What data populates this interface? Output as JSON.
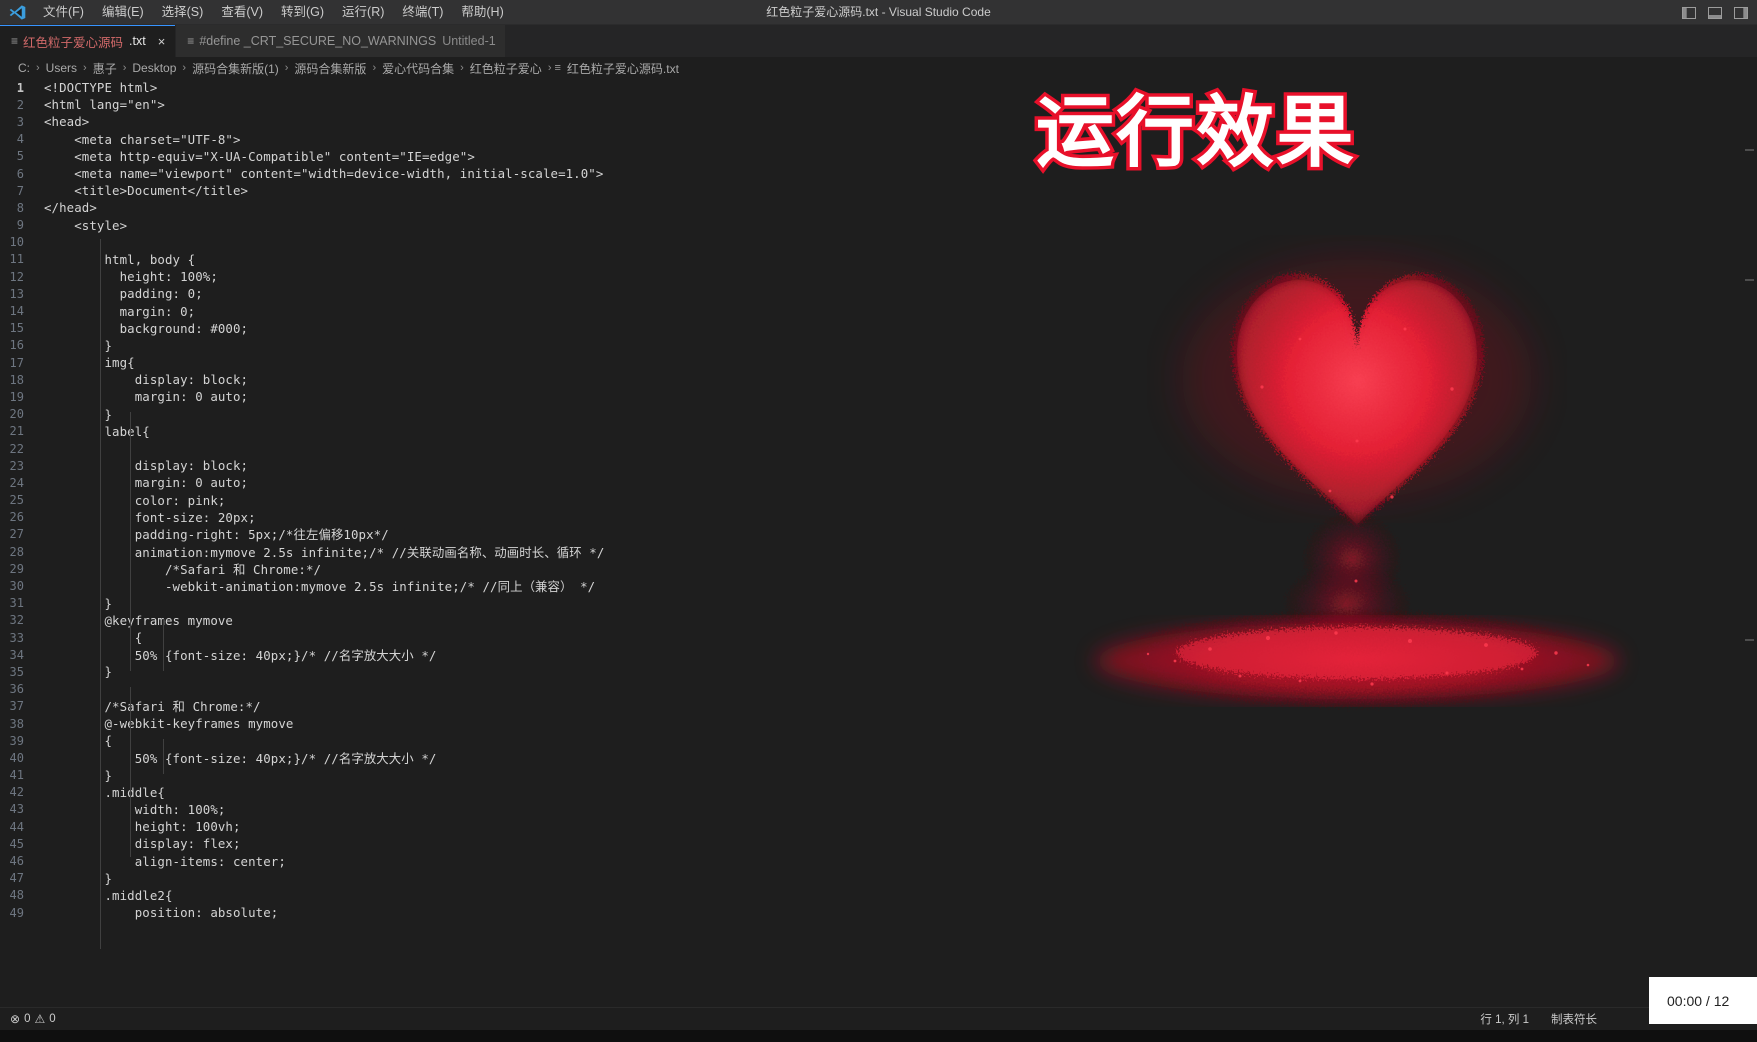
{
  "window": {
    "title": "红色粒子爱心源码.txt - Visual Studio Code",
    "logo_name": "vscode-logo"
  },
  "menu": {
    "items": [
      {
        "label": "文件(F)"
      },
      {
        "label": "编辑(E)"
      },
      {
        "label": "选择(S)"
      },
      {
        "label": "查看(V)"
      },
      {
        "label": "转到(G)"
      },
      {
        "label": "运行(R)"
      },
      {
        "label": "终端(T)"
      },
      {
        "label": "帮助(H)"
      }
    ]
  },
  "title_actions": [
    {
      "name": "toggle-primary-sidebar-icon"
    },
    {
      "name": "toggle-panel-icon"
    },
    {
      "name": "toggle-secondary-sidebar-icon"
    }
  ],
  "tabs": [
    {
      "label": "红色粒子爱心源码",
      "ext": ".txt",
      "active": true,
      "close": "×",
      "icon": "text-file-icon"
    },
    {
      "label": "#define _CRT_SECURE_NO_WARNINGS",
      "sub": "Untitled-1",
      "active": false,
      "dirty": true,
      "icon": "text-file-icon"
    }
  ],
  "breadcrumb": {
    "separator": "›",
    "segments": [
      "C:",
      "Users",
      "惠子",
      "Desktop",
      "源码合集新版(1)",
      "源码合集新版",
      "爱心代码合集",
      "红色粒子爱心"
    ],
    "file": "红色粒子爱心源码.txt"
  },
  "editor": {
    "active_line": 1,
    "lines": [
      {
        "n": 1,
        "text": "<!DOCTYPE html>"
      },
      {
        "n": 2,
        "text": "<html lang=\"en\">"
      },
      {
        "n": 3,
        "text": "<head>"
      },
      {
        "n": 4,
        "text": "    <meta charset=\"UTF-8\">"
      },
      {
        "n": 5,
        "text": "    <meta http-equiv=\"X-UA-Compatible\" content=\"IE=edge\">"
      },
      {
        "n": 6,
        "text": "    <meta name=\"viewport\" content=\"width=device-width, initial-scale=1.0\">"
      },
      {
        "n": 7,
        "text": "    <title>Document</title>"
      },
      {
        "n": 8,
        "text": "</head>"
      },
      {
        "n": 9,
        "text": "    <style>"
      },
      {
        "n": 10,
        "text": ""
      },
      {
        "n": 11,
        "text": "        html, body {"
      },
      {
        "n": 12,
        "text": "          height: 100%;"
      },
      {
        "n": 13,
        "text": "          padding: 0;"
      },
      {
        "n": 14,
        "text": "          margin: 0;"
      },
      {
        "n": 15,
        "text": "          background: #000;"
      },
      {
        "n": 16,
        "text": "        }"
      },
      {
        "n": 17,
        "text": "        img{"
      },
      {
        "n": 18,
        "text": "            display: block;"
      },
      {
        "n": 19,
        "text": "            margin: 0 auto;"
      },
      {
        "n": 20,
        "text": "        }"
      },
      {
        "n": 21,
        "text": "        label{"
      },
      {
        "n": 22,
        "text": ""
      },
      {
        "n": 23,
        "text": "            display: block;"
      },
      {
        "n": 24,
        "text": "            margin: 0 auto;"
      },
      {
        "n": 25,
        "text": "            color: pink;"
      },
      {
        "n": 26,
        "text": "            font-size: 20px;"
      },
      {
        "n": 27,
        "text": "            padding-right: 5px;/*往左偏移10px*/"
      },
      {
        "n": 28,
        "text": "            animation:mymove 2.5s infinite;/* //关联动画名称、动画时长、循环 */"
      },
      {
        "n": 29,
        "text": "                /*Safari 和 Chrome:*/"
      },
      {
        "n": 30,
        "text": "                -webkit-animation:mymove 2.5s infinite;/* //同上（兼容） */"
      },
      {
        "n": 31,
        "text": "        }"
      },
      {
        "n": 32,
        "text": "        @keyframes mymove"
      },
      {
        "n": 33,
        "text": "            {"
      },
      {
        "n": 34,
        "text": "            50% {font-size: 40px;}/* //名字放大大小 */"
      },
      {
        "n": 35,
        "text": "        }"
      },
      {
        "n": 36,
        "text": ""
      },
      {
        "n": 37,
        "text": "        /*Safari 和 Chrome:*/"
      },
      {
        "n": 38,
        "text": "        @-webkit-keyframes mymove"
      },
      {
        "n": 39,
        "text": "        {"
      },
      {
        "n": 40,
        "text": "            50% {font-size: 40px;}/* //名字放大大小 */"
      },
      {
        "n": 41,
        "text": "        }"
      },
      {
        "n": 42,
        "text": "        .middle{"
      },
      {
        "n": 43,
        "text": "            width: 100%;"
      },
      {
        "n": 44,
        "text": "            height: 100vh;"
      },
      {
        "n": 45,
        "text": "            display: flex;"
      },
      {
        "n": 46,
        "text": "            align-items: center;"
      },
      {
        "n": 47,
        "text": "        }"
      },
      {
        "n": 48,
        "text": "        .middle2{"
      },
      {
        "n": 49,
        "text": "            position: absolute;"
      }
    ]
  },
  "run_panel": {
    "title": "运行效果",
    "title_fill": "#ffffff",
    "title_stroke": "#e8102a",
    "heart_color": "#e01030",
    "heart_name": "red-particle-heart"
  },
  "statusbar": {
    "errors_icon": "⊗",
    "errors": "0",
    "warnings_icon": "⚠",
    "warnings": "0",
    "cursor_position": "行 1, 列 1",
    "indent": "制表符长"
  },
  "video_overlay": {
    "time": "00:00 / 12"
  }
}
